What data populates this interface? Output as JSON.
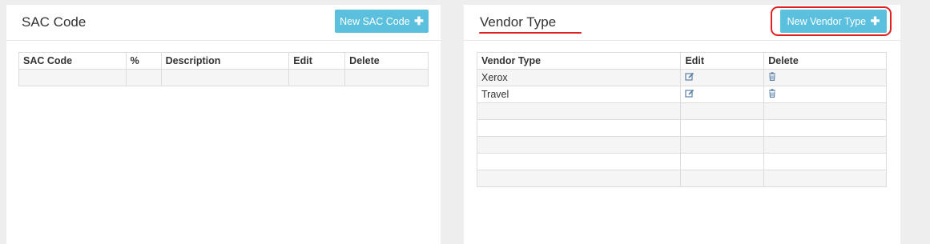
{
  "sac_panel": {
    "title": "SAC Code",
    "new_button_label": "New SAC Code",
    "columns": [
      "SAC Code",
      "%",
      "Description",
      "Edit",
      "Delete"
    ]
  },
  "vendor_panel": {
    "title": "Vendor Type",
    "new_button_label": "New Vendor Type",
    "columns": [
      "Vendor Type",
      "Edit",
      "Delete"
    ],
    "rows": [
      "Xerox",
      "Travel"
    ]
  },
  "icons": {
    "plus": "plus-icon",
    "edit": "edit-icon",
    "delete": "trash-icon"
  },
  "colors": {
    "button": "#5bc0de",
    "annotation": "#e02020"
  }
}
